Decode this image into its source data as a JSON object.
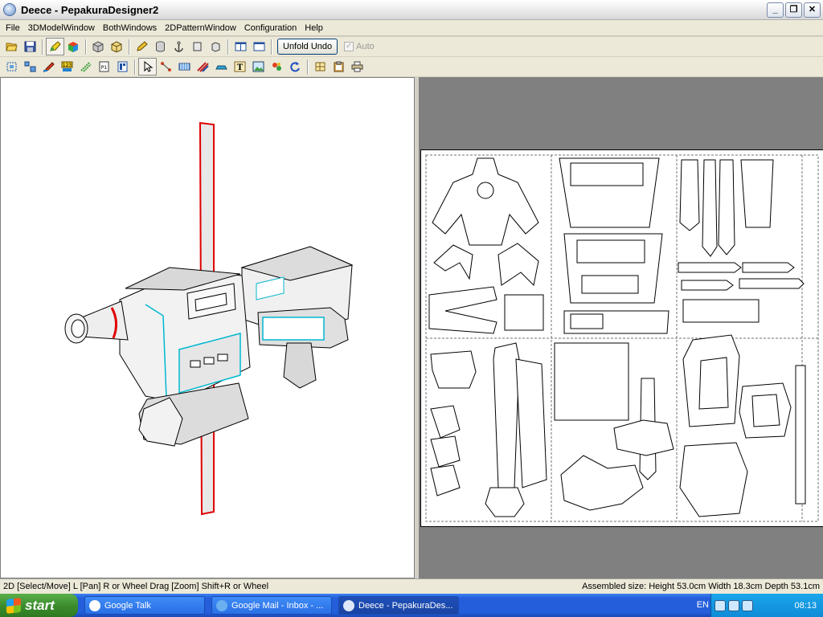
{
  "window": {
    "title": "Deece - PepakuraDesigner2",
    "minimize_label": "_",
    "maximize_label": "❐",
    "close_label": "✕"
  },
  "menu": {
    "items": [
      "File",
      "3DModelWindow",
      "BothWindows",
      "2DPatternWindow",
      "Configuration",
      "Help"
    ]
  },
  "toolbar": {
    "unfold_undo_label": "Unfold Undo",
    "auto_label": "Auto",
    "auto_checked": true
  },
  "status": {
    "left": "2D [Select/Move] L [Pan] R or Wheel Drag [Zoom] Shift+R or Wheel",
    "right": "Assembled size: Height 53.0cm Width 18.3cm Depth 53.1cm"
  },
  "taskbar": {
    "start_label": "start",
    "tasks": [
      {
        "label": "Google Talk",
        "active": false
      },
      {
        "label": "Google Mail - Inbox - ...",
        "active": false
      },
      {
        "label": "Deece - PepakuraDes...",
        "active": true
      }
    ],
    "language": "EN",
    "clock": "08:13"
  },
  "colors": {
    "model_outline": "#000000",
    "model_highlight": "#00c8d8",
    "edge_red": "#e00000",
    "pattern_bg": "#808080"
  }
}
